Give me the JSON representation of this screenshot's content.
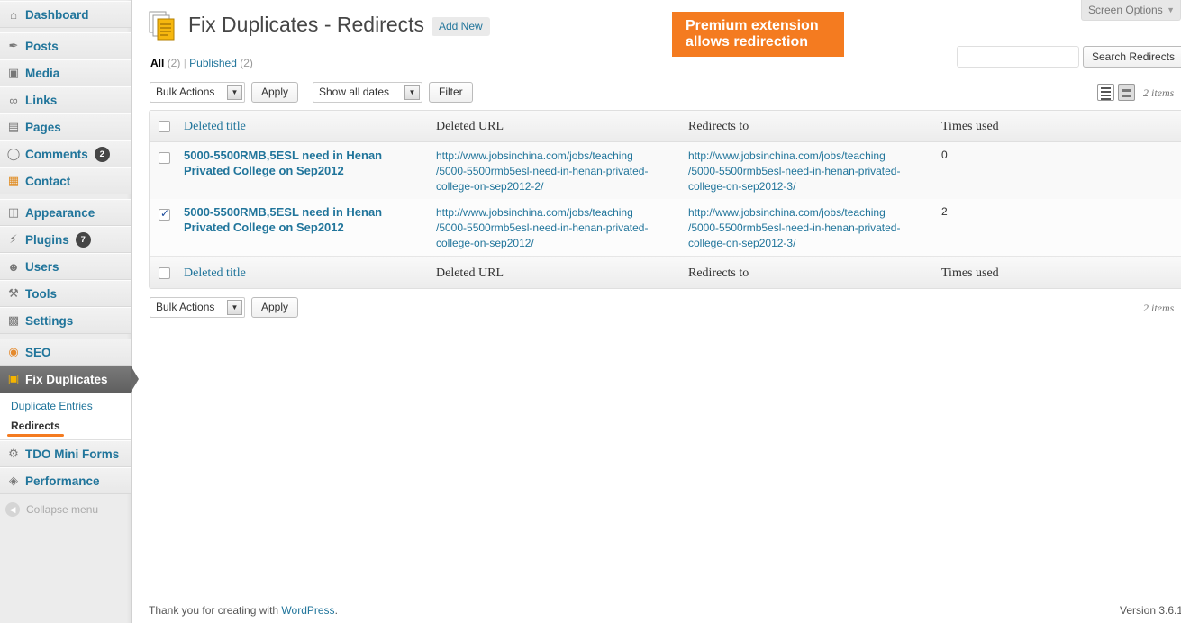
{
  "menu": {
    "dashboard": "Dashboard",
    "posts": "Posts",
    "media": "Media",
    "links": "Links",
    "pages": "Pages",
    "comments": "Comments",
    "comments_badge": "2",
    "contact": "Contact",
    "appearance": "Appearance",
    "plugins": "Plugins",
    "plugins_badge": "7",
    "users": "Users",
    "tools": "Tools",
    "settings": "Settings",
    "seo": "SEO",
    "fix_duplicates": "Fix Duplicates",
    "submenu": {
      "duplicate_entries": "Duplicate Entries",
      "redirects": "Redirects"
    },
    "tdo_mini_forms": "TDO Mini Forms",
    "performance": "Performance",
    "collapse": "Collapse menu"
  },
  "header": {
    "title": "Fix Duplicates - Redirects",
    "add_new": "Add New",
    "promo_line1": "Premium extension",
    "promo_line2": "allows redirection",
    "screen_options": "Screen Options"
  },
  "filters": {
    "all_label": "All",
    "all_count": "(2)",
    "separator": "|",
    "published_label": "Published",
    "published_count": "(2)"
  },
  "search": {
    "button": "Search Redirects"
  },
  "toolbar": {
    "bulk_actions": "Bulk Actions",
    "apply": "Apply",
    "dates": "Show all dates",
    "filter": "Filter",
    "items_count": "2 items"
  },
  "table": {
    "columns": [
      "Deleted title",
      "Deleted URL",
      "Redirects to",
      "Times used"
    ],
    "rows": [
      {
        "title_line1": "5000-5500RMB,5ESL need in Henan",
        "title_line2": "Privated College on Sep2012",
        "deleted_url": [
          "http://www.jobsinchina.com/jobs/teaching",
          "/5000-5500rmb5esl-need-in-henan-privated-",
          "college-on-sep2012-2/"
        ],
        "redirects_to": [
          "http://www.jobsinchina.com/jobs/teaching",
          "/5000-5500rmb5esl-need-in-henan-privated-",
          "college-on-sep2012-3/"
        ],
        "times_used": "0",
        "checked": false
      },
      {
        "title_line1": "5000-5500RMB,5ESL need in Henan",
        "title_line2": "Privated College on Sep2012",
        "deleted_url": [
          "http://www.jobsinchina.com/jobs/teaching",
          "/5000-5500rmb5esl-need-in-henan-privated-",
          "college-on-sep2012/"
        ],
        "redirects_to": [
          "http://www.jobsinchina.com/jobs/teaching",
          "/5000-5500rmb5esl-need-in-henan-privated-",
          "college-on-sep2012-3/"
        ],
        "times_used": "2",
        "checked": true
      }
    ]
  },
  "footer": {
    "thanks_prefix": "Thank you for creating with",
    "wordpress_link": "WordPress",
    "thanks_suffix": ".",
    "version": "Version 3.6.1"
  },
  "colors": {
    "link": "#21759b",
    "promo": "#f47b20",
    "current_menu": "#6a6a6a"
  }
}
